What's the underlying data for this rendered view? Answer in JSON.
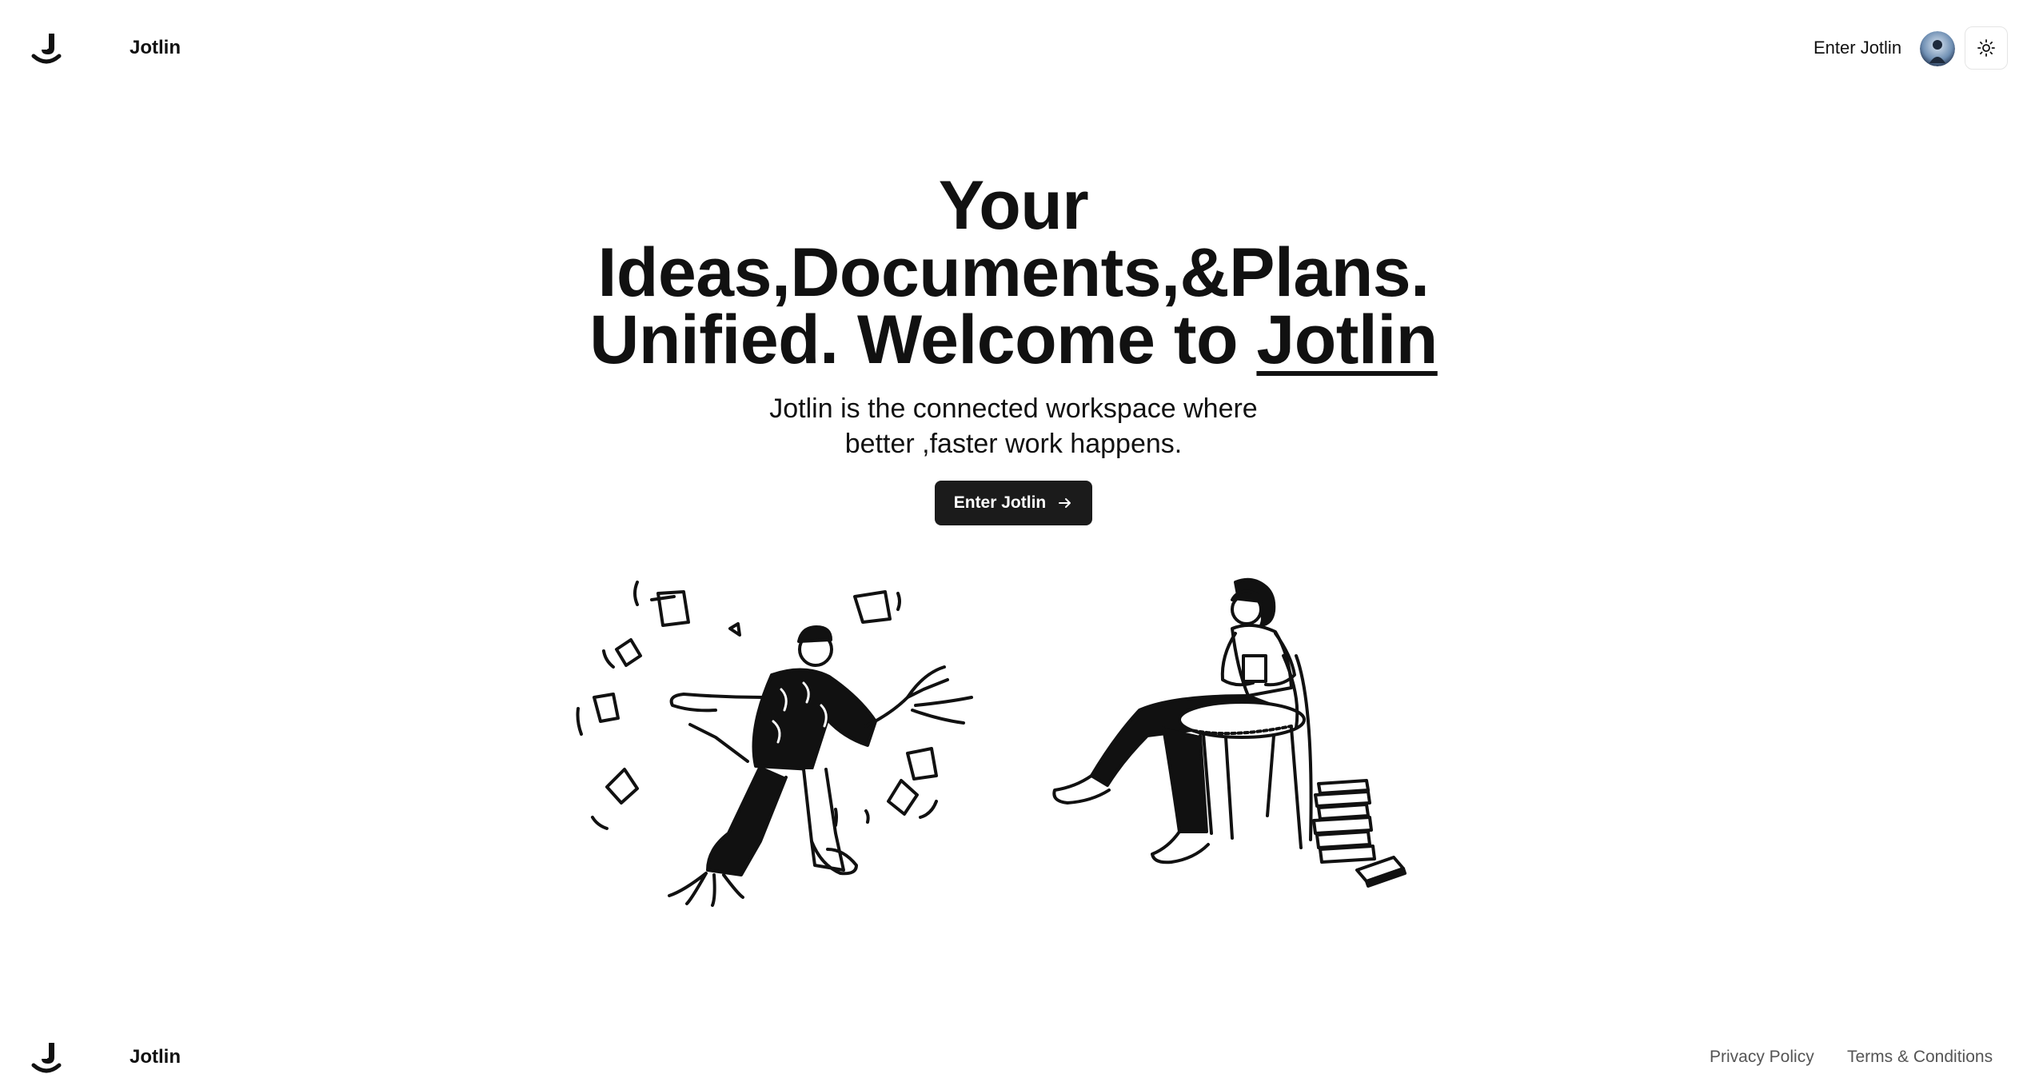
{
  "header": {
    "brand": "Jotlin",
    "nav_link": "Enter Jotlin",
    "logo_icon": "jotlin-logo-icon",
    "avatar_icon": "user-avatar",
    "theme_icon": "sun-icon"
  },
  "hero": {
    "headline_line1": "Your",
    "headline_line2": "Ideas,Documents,&Plans.",
    "headline_line3_prefix": "Unified. Welcome to ",
    "headline_line3_brand": "Jotlin",
    "subtitle_line1": "Jotlin is the connected workspace where",
    "subtitle_line2": "better ,faster work happens.",
    "cta_label": "Enter Jotlin",
    "cta_icon": "arrow-right-icon"
  },
  "illustrations": {
    "left": "person-juggling-papers-illustration",
    "right": "person-reading-illustration"
  },
  "footer": {
    "brand": "Jotlin",
    "privacy": "Privacy Policy",
    "terms": "Terms & Conditions"
  },
  "colors": {
    "text": "#111111",
    "button_bg": "#1b1b1b",
    "button_text": "#ffffff",
    "footer_link": "#555555"
  }
}
